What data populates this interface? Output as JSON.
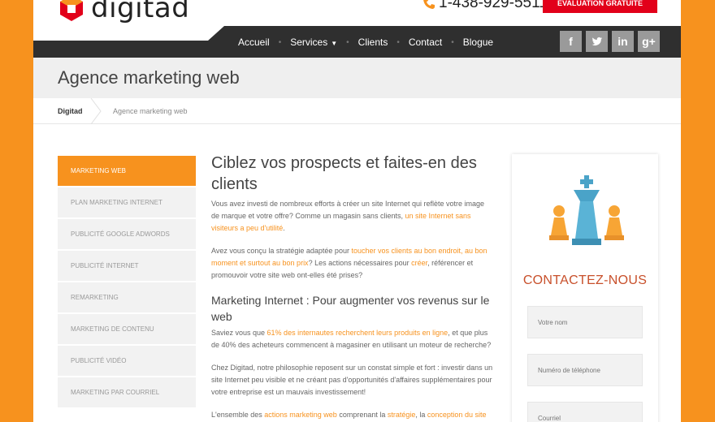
{
  "header": {
    "logo_text": "digitad",
    "phone": "1-438-929-5511",
    "cta_label": "ÉVALUATION GRATUITE"
  },
  "nav": {
    "items": [
      "Accueil",
      "Services",
      "Clients",
      "Contact",
      "Blogue"
    ],
    "separator": "•"
  },
  "social": [
    {
      "icon": "facebook-icon",
      "glyph": "f"
    },
    {
      "icon": "twitter-icon",
      "glyph": "t"
    },
    {
      "icon": "linkedin-icon",
      "glyph": "in"
    },
    {
      "icon": "googleplus-icon",
      "glyph": "g+"
    }
  ],
  "page": {
    "title": "Agence marketing web",
    "breadcrumb_home": "Digitad",
    "breadcrumb_current": "Agence marketing web"
  },
  "sidebar": {
    "items": [
      "MARKETING WEB",
      "PLAN MARKETING INTERNET",
      "PUBLICITÉ GOOGLE ADWORDS",
      "PUBLICITÉ INTERNET",
      "REMARKETING",
      "MARKETING DE CONTENU",
      "PUBLICITÉ VIDÉO",
      "MARKETING PAR COURRIEL"
    ],
    "active_index": 0
  },
  "content": {
    "heading": "Ciblez vos prospects et faites-en des clients",
    "p1": {
      "a": "Vous avez investi de nombreux efforts à créer un site Internet qui reflète votre image de marque et votre offre? Comme un magasin sans clients, ",
      "b": "un site Internet sans visiteurs a peu d'utilité",
      "c": "."
    },
    "p2": {
      "a": "Avez vous conçu la stratégie adaptée pour ",
      "b": "toucher vos clients au bon endroit, au bon moment et surtout au bon prix",
      "c": "? Les actions nécessaires pour ",
      "d": "créer",
      "e": ", référencer et promouvoir votre site web ont-elles été prises?"
    },
    "subheading": "Marketing Internet : Pour augmenter vos revenus sur le web",
    "p3": {
      "a": "Saviez vous que ",
      "b": "61% des internautes recherchent leurs produits en ligne",
      "c": ", et que plus de 40% des acheteurs commencent à magasiner en utilisant un moteur de recherche?"
    },
    "p4": "Chez Digitad, notre philosophie reposent sur un constat simple et fort : investir dans un site Internet peu visible et ne créant pas d'opportunités d'affaires supplémentaires pour votre entreprise est un mauvais investissement!",
    "p5": {
      "a": "L'ensemble des ",
      "b": "actions marketing web",
      "c": " comprenant la ",
      "d": "stratégie",
      "e": ", la ",
      "f": "conception du site"
    }
  },
  "contact": {
    "title": "CONTACTEZ-NOUS",
    "fields": [
      "Votre nom",
      "Numéro de téléphone",
      "Courriel"
    ]
  },
  "colors": {
    "brand_orange": "#f7921e",
    "cta_red": "#e2001a",
    "nav_dark": "#2f2f2f",
    "chess_blue": "#4aa3c8"
  }
}
